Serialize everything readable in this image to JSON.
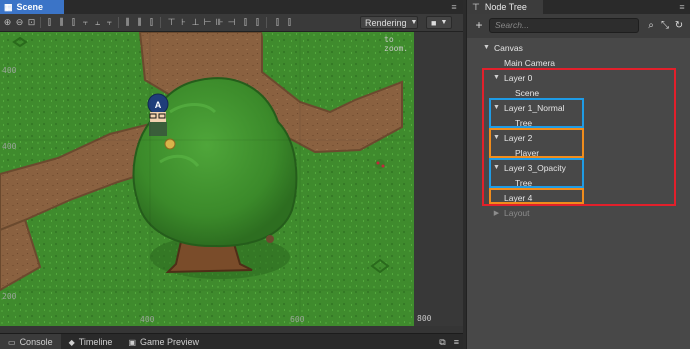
{
  "scene": {
    "tab_label": "Scene",
    "rendering_label": "Rendering",
    "zoom_hint": "to zoom.",
    "ruler_top": "400",
    "ruler_mid": "400",
    "ruler_bottom": "200",
    "x_ticks": [
      "200",
      "400",
      "600"
    ],
    "x_end": "800",
    "avatar_letter": "A"
  },
  "bottom_tabs": [
    {
      "label": "Console"
    },
    {
      "label": "Timeline"
    },
    {
      "label": "Game Preview"
    }
  ],
  "node_tree": {
    "tab_label": "Node Tree",
    "search_placeholder": "Search...",
    "nodes": [
      {
        "label": "Canvas"
      },
      {
        "label": "Main Camera"
      },
      {
        "label": "Layer 0"
      },
      {
        "label": "Scene"
      },
      {
        "label": "Layer 1_Normal"
      },
      {
        "label": "Tree"
      },
      {
        "label": "Layer 2"
      },
      {
        "label": "Player"
      },
      {
        "label": "Layer 3_Opacity"
      },
      {
        "label": "Tree"
      },
      {
        "label": "Layer 4"
      },
      {
        "label": "Layout"
      }
    ]
  },
  "colors": {
    "accent": "#3b74c7",
    "highlight_red": "#e2202b",
    "highlight_blue": "#1f9ce6",
    "highlight_orange": "#f08c1c"
  }
}
